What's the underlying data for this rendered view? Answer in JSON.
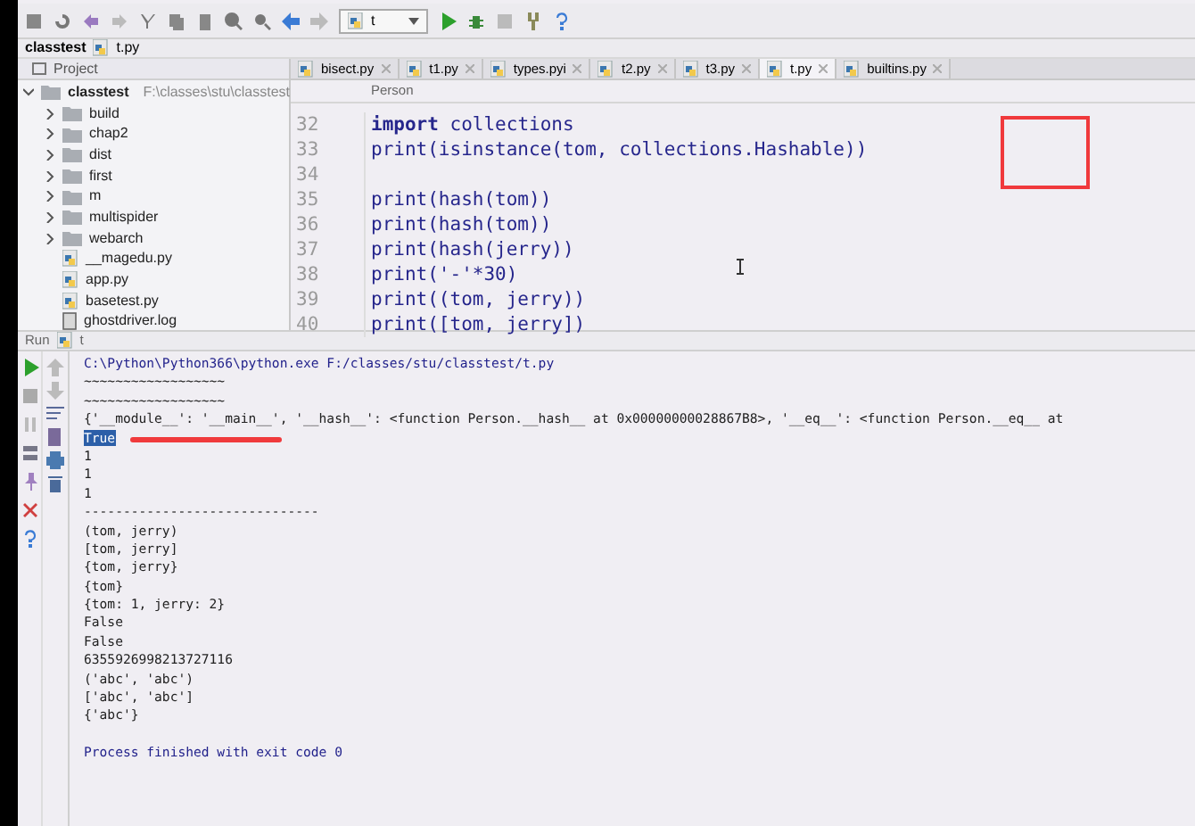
{
  "toolbar": {
    "run_config": "t"
  },
  "breadcrumb": [
    "classtest",
    "t.py"
  ],
  "project_panel": {
    "title": "Project",
    "tree": [
      {
        "name": "classtest",
        "path": "F:\\classes\\stu\\classtest",
        "kind": "folder",
        "expanded": true,
        "children": [
          {
            "name": "build",
            "kind": "folder",
            "expanded": false
          },
          {
            "name": "chap2",
            "kind": "folder",
            "expanded": false
          },
          {
            "name": "dist",
            "kind": "folder",
            "expanded": false
          },
          {
            "name": "first",
            "kind": "folder",
            "expanded": false
          },
          {
            "name": "m",
            "kind": "folder",
            "expanded": false
          },
          {
            "name": "multispider",
            "kind": "folder",
            "expanded": false
          },
          {
            "name": "webarch",
            "kind": "folder",
            "expanded": false
          },
          {
            "name": "__magedu.py",
            "kind": "python"
          },
          {
            "name": "app.py",
            "kind": "python"
          },
          {
            "name": "basetest.py",
            "kind": "python"
          },
          {
            "name": "ghostdriver.log",
            "kind": "log"
          }
        ]
      }
    ]
  },
  "tabs": [
    {
      "label": "bisect.py",
      "selected": false
    },
    {
      "label": "t1.py",
      "selected": false
    },
    {
      "label": "types.pyi",
      "selected": false
    },
    {
      "label": "t2.py",
      "selected": false
    },
    {
      "label": "t3.py",
      "selected": false
    },
    {
      "label": "t.py",
      "selected": true
    },
    {
      "label": "builtins.py",
      "selected": false
    }
  ],
  "editor_breadcrumb": "Person",
  "code": [
    {
      "line": "32",
      "text": "**import** collections"
    },
    {
      "line": "33",
      "text": "print(isinstance(tom, collections.Hashable))"
    },
    {
      "line": "34"
    },
    {
      "line": "35",
      "text": "print(hash(tom))"
    },
    {
      "line": "36",
      "text": "print(hash(tom))"
    },
    {
      "line": "37",
      "text": "print(hash(jerry))"
    },
    {
      "line": "38",
      "text": "print('-'*30)"
    },
    {
      "line": "39",
      "text": "print((tom, jerry))"
    },
    {
      "line": "40",
      "text": "print([tom, jerry])"
    }
  ],
  "run_panel": {
    "title": "Run",
    "config": "t",
    "output": [
      {
        "text": "C:\\Python\\Python366\\python.exe F:/classes/stu/classtest/t.py",
        "kind": "command",
        "selected": false
      },
      {
        "text": "~~~~~~~~~~~~~~~~~~",
        "kind": "out",
        "selected": false
      },
      {
        "text": "~~~~~~~~~~~~~~~~~~",
        "kind": "out",
        "selected": false
      },
      {
        "text": "{'__module__': '__main__', '__hash__': <function Person.__hash__ at 0x00000000028867B8>, '__eq__': <function Person.__eq__ at",
        "kind": "out",
        "selected": false
      },
      {
        "text": "True",
        "kind": "out",
        "selected": true
      },
      {
        "text": "1",
        "kind": "out",
        "selected": false
      },
      {
        "text": "1",
        "kind": "out",
        "selected": false
      },
      {
        "text": "1",
        "kind": "out",
        "selected": false
      },
      {
        "text": "------------------------------",
        "kind": "out",
        "selected": false
      },
      {
        "text": "(tom, jerry)",
        "kind": "out",
        "selected": false
      },
      {
        "text": "[tom, jerry]",
        "kind": "out",
        "selected": false
      },
      {
        "text": "{tom, jerry}",
        "kind": "out",
        "selected": false
      },
      {
        "text": "{tom}",
        "kind": "out",
        "selected": false
      },
      {
        "text": "{tom: 1, jerry: 2}",
        "kind": "out",
        "selected": false
      },
      {
        "text": "False",
        "kind": "out",
        "selected": false
      },
      {
        "text": "False",
        "kind": "out",
        "selected": false
      },
      {
        "text": "6355926998213727116",
        "kind": "out",
        "selected": false
      },
      {
        "text": "('abc', 'abc')",
        "kind": "out",
        "selected": false
      },
      {
        "text": "['abc', 'abc']",
        "kind": "out",
        "selected": false
      },
      {
        "text": "{'abc'}",
        "kind": "out",
        "selected": false
      },
      {
        "kind": "blank"
      },
      {
        "text": "Process finished with exit code 0",
        "kind": "command",
        "selected": false
      }
    ]
  }
}
